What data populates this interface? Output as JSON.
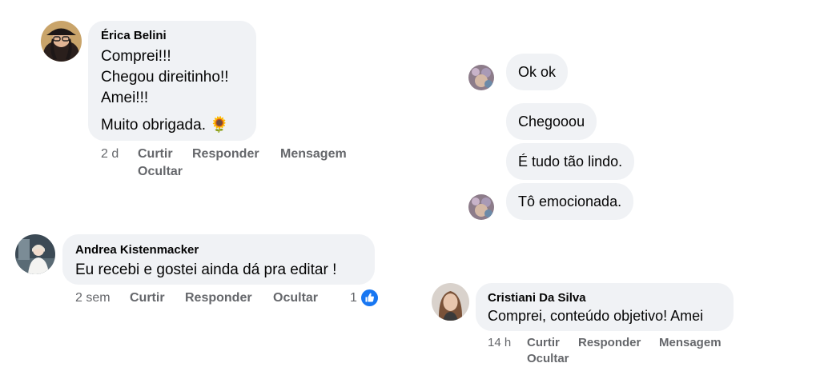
{
  "comments": [
    {
      "author": "Érica Belini",
      "lines": [
        "Comprei!!!",
        "Chegou direitinho!!",
        "Amei!!!",
        "Muito obrigada. 🌻"
      ],
      "time": "2 d",
      "actions": [
        "Curtir",
        "Responder",
        "Mensagem",
        "Ocultar"
      ]
    },
    {
      "author": "Andrea Kistenmacker",
      "lines": [
        "Eu recebi e gostei ainda dá pra editar !"
      ],
      "time": "2 sem",
      "actions": [
        "Curtir",
        "Responder",
        "Ocultar"
      ],
      "reaction_count": "1"
    },
    {
      "author": "Cristiani Da Silva",
      "lines": [
        "Comprei, conteúdo objetivo! Amei"
      ],
      "time": "14 h",
      "actions": [
        "Curtir",
        "Responder",
        "Mensagem",
        "Ocultar"
      ]
    }
  ],
  "chat": {
    "messages": [
      "Ok ok",
      "Chegooou",
      "É tudo tão lindo.",
      "Tô emocionada."
    ]
  },
  "colors": {
    "bubble": "#f0f2f5",
    "secondary_text": "#65676b",
    "like_blue": "#1877f2"
  },
  "icons": {
    "reaction": "like-thumb-icon",
    "sunflower": "sunflower-emoji"
  }
}
